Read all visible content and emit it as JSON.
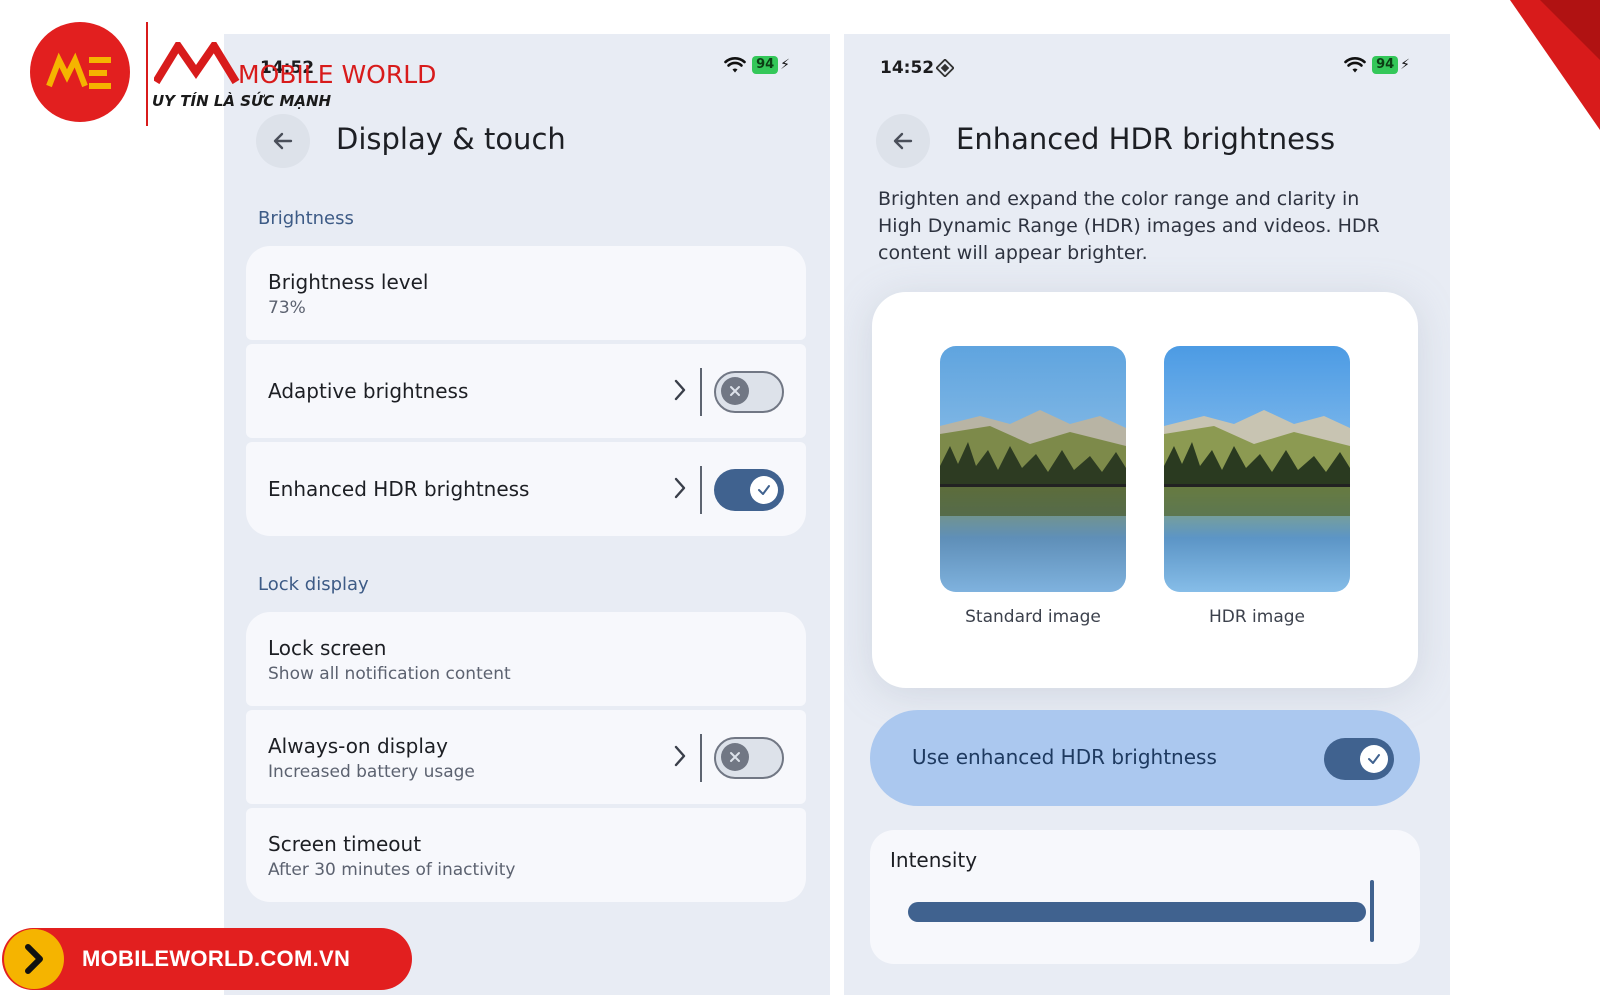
{
  "left_screen": {
    "status": {
      "time": "14:52",
      "battery": "94"
    },
    "title": "Display & touch",
    "brightness_section": {
      "header": "Brightness",
      "items": [
        {
          "title": "Brightness level",
          "subtitle": "73%"
        },
        {
          "title": "Adaptive brightness",
          "toggle": "off"
        },
        {
          "title": "Enhanced HDR brightness",
          "toggle": "on"
        }
      ]
    },
    "lock_section": {
      "header": "Lock display",
      "items": [
        {
          "title": "Lock screen",
          "subtitle": "Show all notification content"
        },
        {
          "title": "Always-on display",
          "subtitle": "Increased battery usage",
          "toggle": "off"
        },
        {
          "title": "Screen timeout",
          "subtitle": "After 30 minutes of inactivity"
        }
      ]
    }
  },
  "right_screen": {
    "status": {
      "time": "14:52",
      "battery": "94"
    },
    "title": "Enhanced HDR brightness",
    "description": "Brighten and expand the color range and clarity in High Dynamic Range (HDR) images and videos. HDR content will appear brighter.",
    "preview": {
      "standard_caption": "Standard image",
      "hdr_caption": "HDR image"
    },
    "toggle_card": {
      "label": "Use enhanced HDR brightness",
      "state": "on"
    },
    "intensity": {
      "label": "Intensity",
      "value_fraction": 1.0
    }
  },
  "watermark": {
    "brand": "MOBILE WORLD",
    "slogan": "UY TÍN LÀ SỨC MẠNH",
    "url": "MOBILEWORLD.COM.VN"
  },
  "colors": {
    "accent": "#40628f",
    "toggle_card_bg": "#abc8ef",
    "panel_bg": "#e8ecf4",
    "brand_red": "#e21f1f"
  }
}
